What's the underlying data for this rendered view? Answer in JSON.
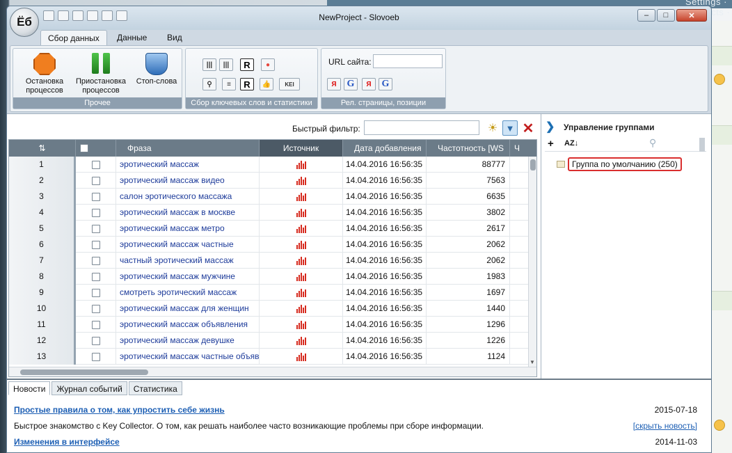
{
  "background": {
    "topbar_text": "Settings · Contacts · About"
  },
  "window": {
    "title": "NewProject - Slovoeb",
    "logo_text": "Ёб"
  },
  "ribbon": {
    "tabs": [
      {
        "label": "Сбор данных",
        "active": true
      },
      {
        "label": "Данные",
        "active": false
      },
      {
        "label": "Вид",
        "active": false
      }
    ],
    "groups": {
      "misc": {
        "label": "Прочее",
        "stop_label": "Остановка процессов",
        "pause_label": "Приостановка процессов",
        "stopwords_label": "Стоп-слова"
      },
      "keywords": {
        "label": "Сбор ключевых слов и статистики",
        "kei_label": "KEI"
      },
      "rel": {
        "label": "Рел. страницы, позиции",
        "url_label": "URL сайта:",
        "url_value": ""
      }
    }
  },
  "filter": {
    "label": "Быстрый фильтр:",
    "value": ""
  },
  "grid": {
    "columns": {
      "phrase": "Фраза",
      "source": "Источник",
      "date": "Дата добавления",
      "freq": "Частотность [WS",
      "more": "Ч"
    },
    "rows": [
      {
        "num": "1",
        "phrase": "эротический массаж",
        "date": "14.04.2016 16:56:35",
        "freq": "88777"
      },
      {
        "num": "2",
        "phrase": "эротический массаж видео",
        "date": "14.04.2016 16:56:35",
        "freq": "7563"
      },
      {
        "num": "3",
        "phrase": "салон эротического массажа",
        "date": "14.04.2016 16:56:35",
        "freq": "6635"
      },
      {
        "num": "4",
        "phrase": "эротический массаж в москве",
        "date": "14.04.2016 16:56:35",
        "freq": "3802"
      },
      {
        "num": "5",
        "phrase": "эротический массаж метро",
        "date": "14.04.2016 16:56:35",
        "freq": "2617"
      },
      {
        "num": "6",
        "phrase": "эротический массаж частные",
        "date": "14.04.2016 16:56:35",
        "freq": "2062"
      },
      {
        "num": "7",
        "phrase": "частный эротический массаж",
        "date": "14.04.2016 16:56:35",
        "freq": "2062"
      },
      {
        "num": "8",
        "phrase": "эротический массаж мужчине",
        "date": "14.04.2016 16:56:35",
        "freq": "1983"
      },
      {
        "num": "9",
        "phrase": "смотреть эротический массаж",
        "date": "14.04.2016 16:56:35",
        "freq": "1697"
      },
      {
        "num": "10",
        "phrase": "эротический массаж для женщин",
        "date": "14.04.2016 16:56:35",
        "freq": "1440"
      },
      {
        "num": "11",
        "phrase": "эротический массаж объявления",
        "date": "14.04.2016 16:56:35",
        "freq": "1296"
      },
      {
        "num": "12",
        "phrase": "эротический массаж девушке",
        "date": "14.04.2016 16:56:35",
        "freq": "1226"
      },
      {
        "num": "13",
        "phrase": "эротический массаж частные объяв",
        "date": "14.04.2016 16:56:35",
        "freq": "1124"
      }
    ]
  },
  "groups_panel": {
    "title": "Управление группами",
    "default_group": "Группа по умолчанию (250)"
  },
  "bottom": {
    "tabs": [
      {
        "label": "Новости",
        "active": true
      },
      {
        "label": "Журнал событий",
        "active": false
      },
      {
        "label": "Статистика",
        "active": false
      }
    ],
    "news": [
      {
        "title": "Простые правила о том, как упростить себе жизнь",
        "date": "2015-07-18"
      },
      {
        "text": "Быстрое знакомство с Key Collector. О том, как решать наиболее часто возникающие проблемы при сборе информации.",
        "link": "[скрыть новость]"
      },
      {
        "title": "Изменения в интерфейсе",
        "date": "2014-11-03"
      }
    ]
  }
}
